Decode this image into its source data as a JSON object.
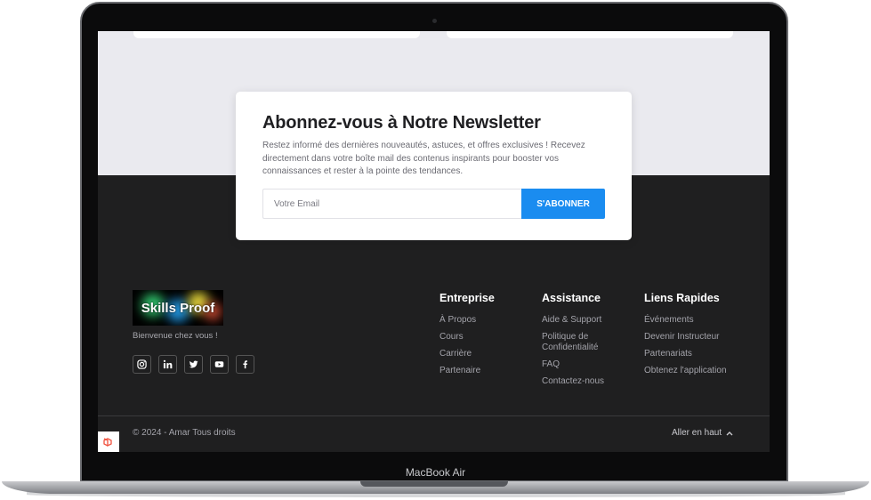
{
  "device": {
    "model_label": "MacBook Air"
  },
  "newsletter": {
    "title": "Abonnez-vous à Notre Newsletter",
    "description": "Restez informé des dernières nouveautés, astuces, et offres exclusives ! Recevez directement dans votre boîte mail des contenus inspirants pour booster vos connaissances et rester à la pointe des tendances.",
    "email_placeholder": "Votre Email",
    "subscribe_label": "S'ABONNER"
  },
  "brand": {
    "logo_text": "Skills Proof",
    "welcome": "Bienvenue chez vous !",
    "socials": [
      {
        "icon": "instagram-icon"
      },
      {
        "icon": "linkedin-icon"
      },
      {
        "icon": "twitter-icon"
      },
      {
        "icon": "youtube-icon"
      },
      {
        "icon": "facebook-icon"
      }
    ]
  },
  "footer": {
    "columns": [
      {
        "title": "Entreprise",
        "links": [
          "À Propos",
          "Cours",
          "Carrière",
          "Partenaire"
        ]
      },
      {
        "title": "Assistance",
        "links": [
          "Aide & Support",
          "Politique de Confidentialité",
          "FAQ",
          "Contactez-nous"
        ]
      },
      {
        "title": "Liens Rapides",
        "links": [
          "Événements",
          "Devenir Instructeur",
          "Partenariats",
          "Obtenez l'application"
        ]
      }
    ],
    "copyright": "© 2024 - Amar Tous droits",
    "back_to_top": "Aller en haut"
  },
  "colors": {
    "accent": "#1a8cf0",
    "footer_bg": "#1f1f20",
    "section_bg": "#eaeaef"
  }
}
